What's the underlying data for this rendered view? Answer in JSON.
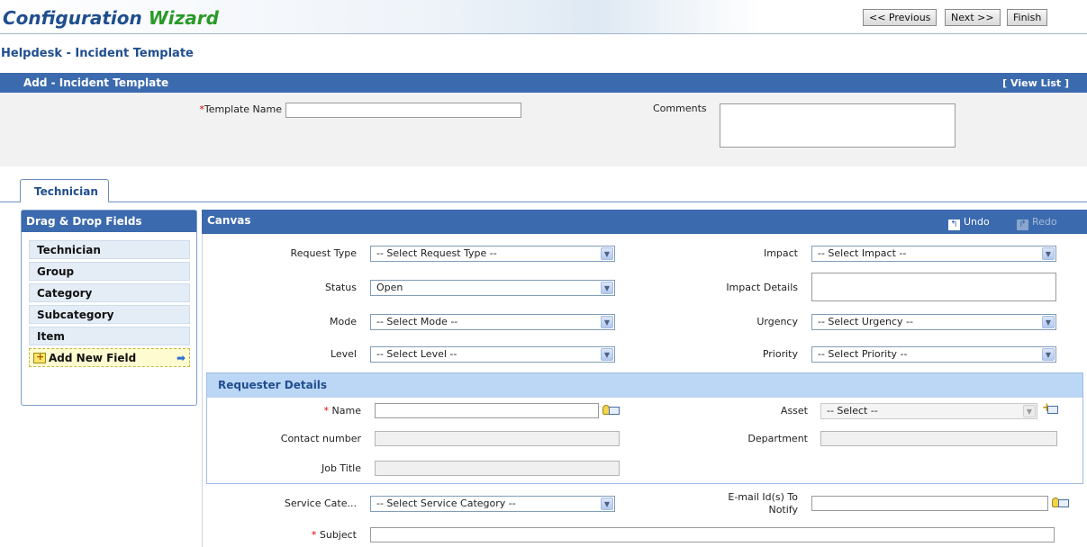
{
  "wizard": {
    "title_part1": "Configuration",
    "title_part2": "Wizard",
    "prev_label": "<< Previous",
    "next_label": "Next >>",
    "finish_label": "Finish"
  },
  "subtitle": "Helpdesk - Incident Template",
  "add_bar": {
    "title": "Add - Incident Template",
    "view_list": "[ View List ]"
  },
  "template_form": {
    "template_name_label": "Template Name",
    "template_name_value": "",
    "comments_label": "Comments",
    "comments_value": "",
    "required_mark": "*"
  },
  "tabs": [
    {
      "label": "Technician"
    }
  ],
  "left_panel": {
    "title": "Drag & Drop Fields",
    "items": [
      {
        "label": "Technician"
      },
      {
        "label": "Group"
      },
      {
        "label": "Category"
      },
      {
        "label": "Subcategory"
      },
      {
        "label": "Item"
      }
    ],
    "add_new_label": "Add New Field"
  },
  "canvas": {
    "title": "Canvas",
    "undo_label": "Undo",
    "redo_label": "Redo",
    "fields": {
      "request_type": {
        "label": "Request Type",
        "value": "-- Select Request Type --"
      },
      "status": {
        "label": "Status",
        "value": "Open"
      },
      "mode": {
        "label": "Mode",
        "value": "-- Select Mode --"
      },
      "level": {
        "label": "Level",
        "value": "-- Select Level --"
      },
      "impact": {
        "label": "Impact",
        "value": "-- Select Impact --"
      },
      "impact_details": {
        "label": "Impact Details",
        "value": ""
      },
      "urgency": {
        "label": "Urgency",
        "value": "-- Select Urgency --"
      },
      "priority": {
        "label": "Priority",
        "value": "-- Select Priority --"
      },
      "service_category": {
        "label": "Service Cate...",
        "value": "-- Select Service Category --"
      },
      "email_ids": {
        "label_line1": "E-mail Id(s) To",
        "label_line2": "Notify",
        "value": ""
      },
      "subject": {
        "label": "Subject",
        "value": ""
      }
    },
    "requester": {
      "title": "Requester Details",
      "name_label": "Name",
      "name_value": "",
      "contact_label": "Contact number",
      "contact_value": "",
      "job_title_label": "Job Title",
      "job_title_value": "",
      "asset_label": "Asset",
      "asset_value": "-- Select --",
      "department_label": "Department",
      "department_value": ""
    }
  }
}
